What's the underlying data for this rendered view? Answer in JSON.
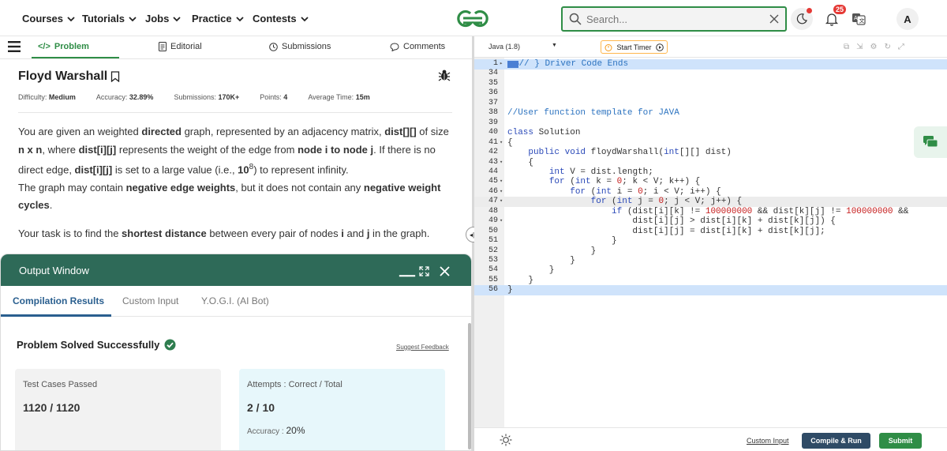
{
  "nav": {
    "items": [
      "Courses",
      "Tutorials",
      "Jobs",
      "Practice",
      "Contests"
    ],
    "search_placeholder": "Search...",
    "notification_count": "25",
    "avatar": "A"
  },
  "problem_tabs": {
    "problem": "Problem",
    "editorial": "Editorial",
    "submissions": "Submissions",
    "comments": "Comments"
  },
  "problem": {
    "title": "Floyd Warshall",
    "meta": {
      "difficulty_label": "Difficulty:",
      "difficulty": "Medium",
      "accuracy_label": "Accuracy:",
      "accuracy": "32.89%",
      "submissions_label": "Submissions:",
      "submissions": "170K+",
      "points_label": "Points:",
      "points": "4",
      "avg_time_label": "Average Time:",
      "avg_time": "15m"
    },
    "desc": {
      "p1a": "You are given an weighted ",
      "p1b": "directed",
      "p1c": " graph, represented by an adjacency matrix, ",
      "p1d": "dist[][]",
      "p1e": " of size ",
      "p1f": "n x n",
      "p1g": ", where ",
      "p1h": "dist[i][j]",
      "p1i": " represents the weight of the edge from ",
      "p1j": "node i to node j",
      "p1k": ". If there is no direct edge, ",
      "p1l": "dist[i][j]",
      "p1m": " is set to a large value (i.e., ",
      "p1n": "10",
      "p1o": "8",
      "p1p": ") to represent infinity.",
      "p2a": "The graph may contain ",
      "p2b": "negative edge weights",
      "p2c": ", but it does not contain any ",
      "p2d": "negative weight cycles",
      "p2e": ".",
      "p3a": "Your task is to find the ",
      "p3b": "shortest distance",
      "p3c": " between every pair of nodes ",
      "p3d": "i",
      "p3e": " and ",
      "p3f": "j",
      "p3g": " in the graph."
    }
  },
  "output": {
    "title": "Output Window",
    "tabs": [
      "Compilation Results",
      "Custom Input",
      "Y.O.G.I. (AI Bot)"
    ],
    "status": "Problem Solved Successfully",
    "feedback": "Suggest Feedback",
    "tests_label": "Test Cases Passed",
    "tests_value": "1120 / 1120",
    "attempts_label": "Attempts : Correct / Total",
    "attempts_value": "2 / 10",
    "accuracy_label": "Accuracy :",
    "accuracy_value": "20%"
  },
  "editor": {
    "language": "Java (1.8)",
    "timer": "Start Timer",
    "custom_input": "Custom Input",
    "compile_run": "Compile & Run",
    "submit": "Submit",
    "lines": [
      {
        "n": "1",
        "fold": "▸",
        "hl": "blue",
        "html": "<span style=\"background:#4a7fd4;color:#4a7fd4;font-size:8px\">▭▭▭</span><span class=\"cm\">// } Driver Code Ends</span>"
      },
      {
        "n": "34",
        "html": ""
      },
      {
        "n": "35",
        "html": ""
      },
      {
        "n": "36",
        "html": ""
      },
      {
        "n": "37",
        "html": ""
      },
      {
        "n": "38",
        "html": "<span class=\"cm\">//User function template for JAVA</span>"
      },
      {
        "n": "39",
        "html": ""
      },
      {
        "n": "40",
        "html": "<span class=\"kw\">class</span> Solution"
      },
      {
        "n": "41",
        "fold": "▾",
        "html": "{"
      },
      {
        "n": "42",
        "html": "    <span class=\"kw\">public</span> <span class=\"kw\">void</span> floydWarshall(<span class=\"kw\">int</span>[][] dist)"
      },
      {
        "n": "43",
        "fold": "▾",
        "html": "    {"
      },
      {
        "n": "44",
        "html": "        <span class=\"kw\">int</span> V = dist.length;"
      },
      {
        "n": "45",
        "fold": "▾",
        "html": "        <span class=\"kw\">for</span> (<span class=\"kw\">int</span> k = <span class=\"num\">0</span>; k &lt; V; k++) {"
      },
      {
        "n": "46",
        "fold": "▾",
        "html": "            <span class=\"kw\">for</span> (<span class=\"kw\">int</span> i = <span class=\"num\">0</span>; i &lt; V; i++) {"
      },
      {
        "n": "47",
        "fold": "▾",
        "hl": "gray",
        "html": "                <span class=\"kw\">for</span> (<span class=\"kw\">int</span> j = <span class=\"num\">0</span>; j &lt; V; j++) {"
      },
      {
        "n": "48",
        "html": "                    <span class=\"kw\">if</span> (dist[i][k] != <span class=\"num\">100000000</span> &amp;&amp; dist[k][j] != <span class=\"num\">100000000</span> &amp;&amp;"
      },
      {
        "n": "49",
        "fold": "▾",
        "html": "                        dist[i][j] &gt; dist[i][k] + dist[k][j]) {"
      },
      {
        "n": "50",
        "html": "                        dist[i][j] = dist[i][k] + dist[k][j];"
      },
      {
        "n": "51",
        "html": "                    }"
      },
      {
        "n": "52",
        "html": "                }"
      },
      {
        "n": "53",
        "html": "            }"
      },
      {
        "n": "54",
        "html": "        }"
      },
      {
        "n": "55",
        "html": "    }"
      },
      {
        "n": "56",
        "hl": "blue",
        "html": "}"
      }
    ]
  }
}
